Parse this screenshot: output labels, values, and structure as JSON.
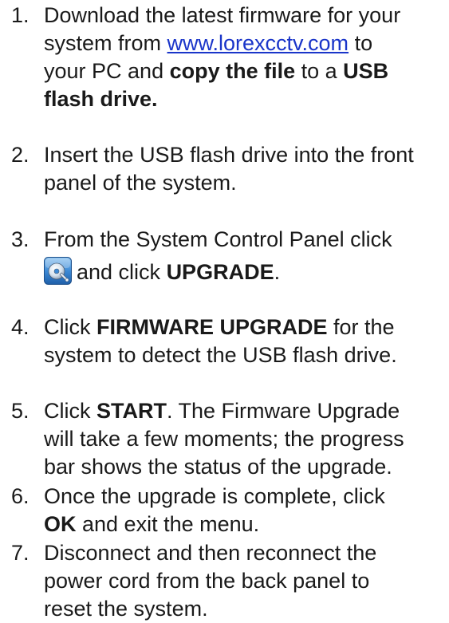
{
  "steps": [
    {
      "number": "1.",
      "line1": "Download the latest firmware for your",
      "line2_pre": "system from ",
      "link": "www.lorexcctv.com",
      "line2_post": " to",
      "line3_pre": "your PC and ",
      "line3_bold1": "copy the file",
      "line3_mid": " to a ",
      "line3_bold2": "USB",
      "line4_bold": "flash drive."
    },
    {
      "number": "2.",
      "line1": "Insert the USB flash drive into the front",
      "line2": "panel of the system."
    },
    {
      "number": "3.",
      "line1": "From the System Control Panel click",
      "icon": "upgrade-disc-icon",
      "line2_pre": "and click ",
      "line2_bold": "UPGRADE",
      "line2_post": "."
    },
    {
      "number": "4.",
      "line1_pre": "Click ",
      "line1_bold": "FIRMWARE UPGRADE",
      "line1_post": " for the",
      "line2": "system to detect the USB flash drive."
    },
    {
      "number": "5.",
      "line1_pre": "Click ",
      "line1_bold": "START",
      "line1_post": ". The Firmware Upgrade",
      "line2": "will take a few moments; the progress",
      "line3": "bar shows the status of the upgrade."
    },
    {
      "number": "6.",
      "line1": "Once the upgrade is complete, click",
      "line2_bold": "OK",
      "line2_post": " and exit the menu."
    },
    {
      "number": "7.",
      "line1": "Disconnect and then reconnect the",
      "line2": "power cord from the back panel to",
      "line3": "reset the system."
    }
  ],
  "colors": {
    "text": "#1a1a1a",
    "link": "#1a35c9",
    "icon_blue": "#2f7fcf"
  }
}
